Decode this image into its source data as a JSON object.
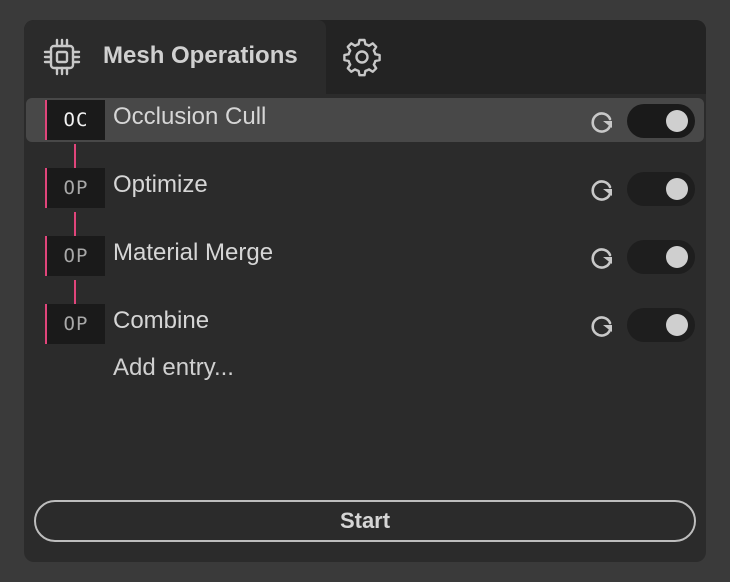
{
  "tabs": {
    "active": {
      "title": "Mesh Operations",
      "icon": "cpu-chip-icon"
    },
    "settings": {
      "icon": "gear-icon"
    }
  },
  "operations": [
    {
      "badge": "OC",
      "label": "Occlusion Cull",
      "selected": true,
      "enabled": true
    },
    {
      "badge": "OP",
      "label": "Optimize",
      "selected": false,
      "enabled": true
    },
    {
      "badge": "OP",
      "label": "Material Merge",
      "selected": false,
      "enabled": true
    },
    {
      "badge": "OP",
      "label": "Combine",
      "selected": false,
      "enabled": true
    }
  ],
  "add_entry_label": "Add entry...",
  "start_label": "Start",
  "colors": {
    "accent": "#e0457b",
    "panel": "#2b2b2b",
    "background": "#3a3a3a"
  }
}
